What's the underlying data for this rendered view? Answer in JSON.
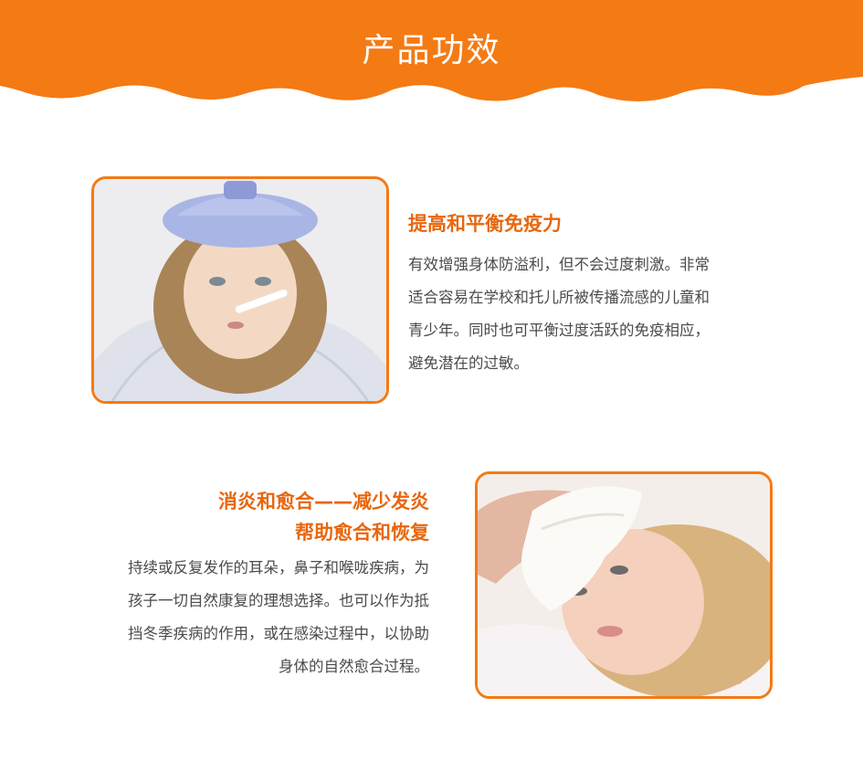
{
  "header": {
    "title": "产品功效",
    "color": "#f47a14"
  },
  "sections": [
    {
      "heading": [
        "提高和平衡免疫力"
      ],
      "body": [
        "有效增强身体防溢利，但不会过度刺激。非常",
        "适合容易在学校和托儿所被传播流感的儿童和",
        "青少年。同时也可平衡过度活跃的免疫相应，",
        "避免潜在的过敏。"
      ],
      "image_icon": "sick-girl-ice-pack-photo"
    },
    {
      "heading": [
        "消炎和愈合——减少发炎",
        "帮助愈合和恢复"
      ],
      "body": [
        "持续或反复发作的耳朵，鼻子和喉咙疾病，为",
        "孩子一切自然康复的理想选择。也可以作为抵",
        "挡冬季疾病的作用，或在感染过程中，以协助",
        "身体的自然愈合过程。"
      ],
      "image_icon": "sick-child-cold-compress-photo"
    }
  ],
  "colors": {
    "accent": "#f47a14",
    "heading": "#e8660d",
    "text": "#4a4a4a"
  }
}
